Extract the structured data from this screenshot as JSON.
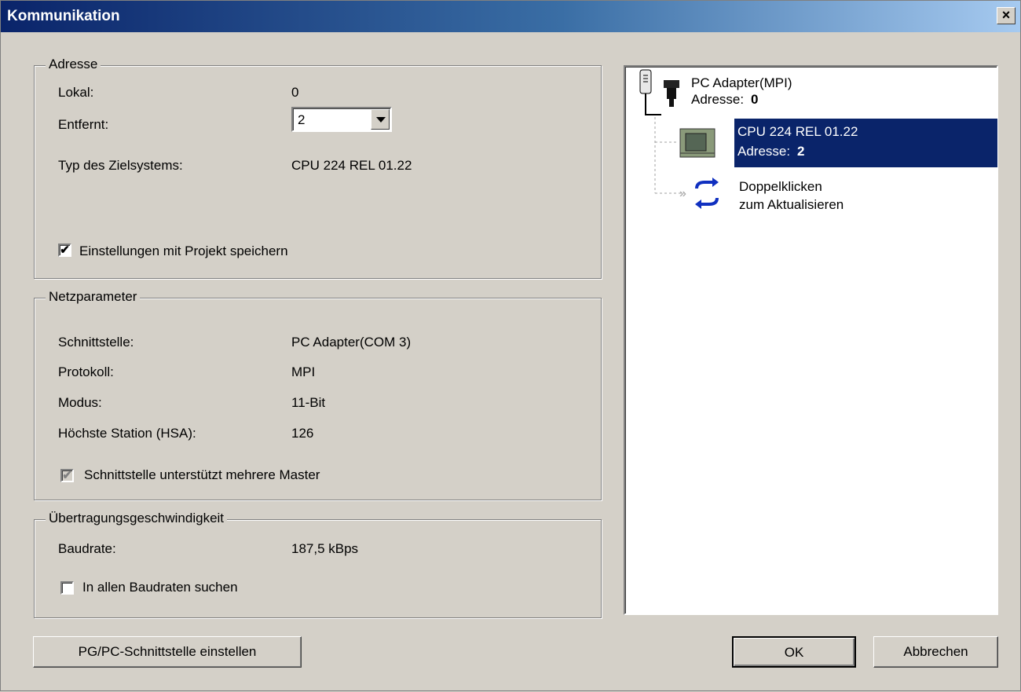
{
  "window": {
    "title": "Kommunikation",
    "close": "×"
  },
  "adresse": {
    "legend": "Adresse",
    "lokal_label": "Lokal:",
    "lokal_value": "0",
    "entfernt_label": "Entfernt:",
    "entfernt_value": "2",
    "typ_label": "Typ des Zielsystems:",
    "typ_value": "CPU 224 REL 01.22",
    "save_checkbox_label": "Einstellungen mit Projekt speichern",
    "save_checked": true
  },
  "netz": {
    "legend": "Netzparameter",
    "rows": [
      {
        "label": "Schnittstelle:",
        "value": "PC Adapter(COM 3)"
      },
      {
        "label": "Protokoll:",
        "value": "MPI"
      },
      {
        "label": "Modus:",
        "value": "11-Bit"
      },
      {
        "label": "Höchste Station (HSA):",
        "value": "126"
      }
    ],
    "multimaster_label": "Schnittstelle unterstützt mehrere Master",
    "multimaster_checked": true
  },
  "speed": {
    "legend": "Übertragungsgeschwindigkeit",
    "baud_label": "Baudrate:",
    "baud_value": "187,5 kBps",
    "search_label": "In allen Baudraten suchen",
    "search_checked": false
  },
  "tree": {
    "adapter_name": "PC Adapter(MPI)",
    "adapter_addr_label": "Adresse:",
    "adapter_addr": "0",
    "cpu_name": "CPU 224 REL 01.22",
    "cpu_addr_label": "Adresse:",
    "cpu_addr": "2",
    "refresh_line1": "Doppelklicken",
    "refresh_line2": "zum Aktualisieren"
  },
  "buttons": {
    "pgpc": "PG/PC-Schnittstelle einstellen",
    "ok": "OK",
    "cancel": "Abbrechen"
  }
}
